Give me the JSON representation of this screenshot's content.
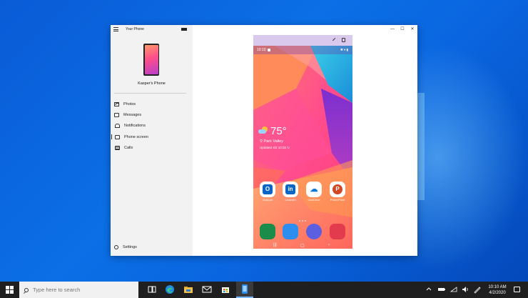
{
  "window": {
    "title": "Your Phone",
    "controls": [
      "—",
      "☐",
      "✕"
    ]
  },
  "sidebar": {
    "phone_name": "Kasper's Phone",
    "items": [
      {
        "label": "Photos",
        "icon": "photos-icon"
      },
      {
        "label": "Messages",
        "icon": "messages-icon"
      },
      {
        "label": "Notifications",
        "icon": "notifications-icon"
      },
      {
        "label": "Phone screen",
        "icon": "phone-screen-icon",
        "active": true
      },
      {
        "label": "Calls",
        "icon": "calls-icon"
      }
    ],
    "settings_label": "Settings"
  },
  "phone": {
    "status_time": "10:10",
    "status_icons": "✱ ▾ ▮",
    "weather": {
      "temp": "75°",
      "location": "⚲ Park Valley",
      "updated": "Updated 4/2 10:02 ↻"
    },
    "apps": [
      {
        "label": "Outlook",
        "letter": "O",
        "color": "#0a64c8"
      },
      {
        "label": "LinkedIn",
        "letter": "in",
        "color": "#0a66c2"
      },
      {
        "label": "OneDrive",
        "letter": "☁",
        "color": "#ffffff"
      },
      {
        "label": "PowerPoint",
        "letter": "P",
        "color": "#d24726"
      }
    ],
    "dock_colors": [
      "#1c8c4a",
      "#2d8ef0",
      "#5b5fe0",
      "#e23b4e"
    ],
    "nav": [
      "|||",
      "▢",
      "‹"
    ]
  },
  "taskbar": {
    "search_placeholder": "Type here to search",
    "time": "10:10 AM",
    "date": "4/2/2020"
  },
  "colors": {
    "desktop": "#0a5bd6",
    "taskbar": "#1f1f1f",
    "sidebar": "#f2f2f2",
    "mirror_bar": "#d9c9ec"
  }
}
